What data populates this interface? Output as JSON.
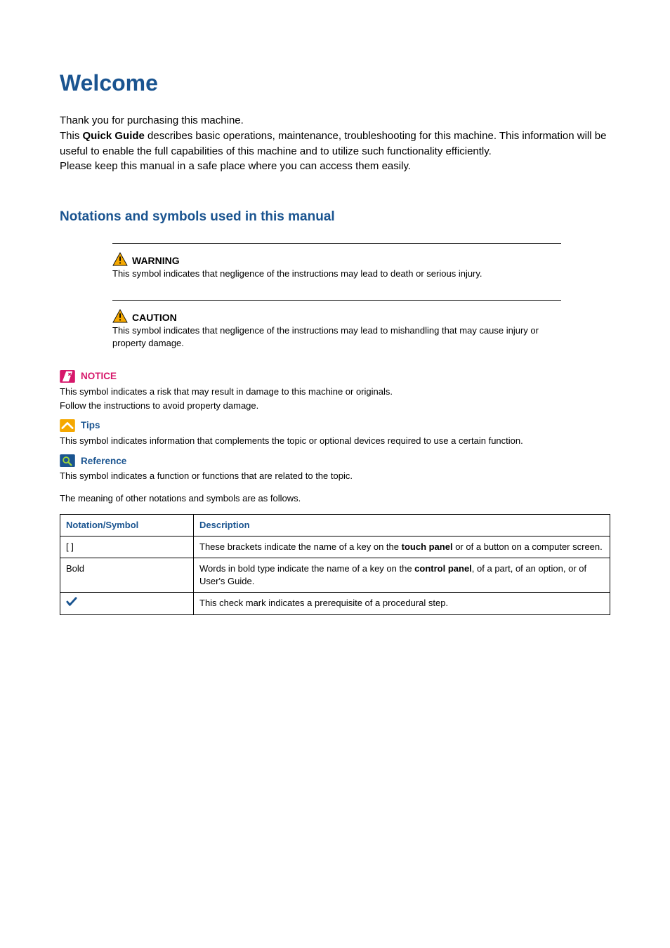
{
  "title": "Welcome",
  "intro": {
    "line1": "Thank you for purchasing this machine.",
    "line2_pre": "This ",
    "line2_bold": "Quick Guide",
    "line2_post": " describes basic operations, maintenance, troubleshooting for this machine. This information will be useful to enable the full capabilities of this machine and to utilize such functionality efficiently.",
    "line3": "Please keep this manual in a safe place where you can access them easily."
  },
  "section_heading": "Notations and symbols used in this manual",
  "warning": {
    "label": "WARNING",
    "text": "This symbol indicates that negligence of the instructions may lead to death or serious injury."
  },
  "caution": {
    "label": "CAUTION",
    "text": "This symbol indicates that negligence of the instructions may lead to mishandling that may cause injury or property damage."
  },
  "notice": {
    "label": "NOTICE",
    "text1": "This symbol indicates a risk that may result in damage to this machine or originals.",
    "text2": "Follow the instructions to avoid property damage."
  },
  "tips": {
    "label": "Tips",
    "text": "This symbol indicates information that complements the topic or optional devices required to use a certain function."
  },
  "reference": {
    "label": "Reference",
    "text": "This symbol indicates a function or functions that are related to the topic."
  },
  "table_intro": "The meaning of other notations and symbols are as follows.",
  "table": {
    "headers": {
      "col1": "Notation/Symbol",
      "col2": "Description"
    },
    "rows": [
      {
        "notation": "[ ]",
        "desc_pre": "These brackets indicate the name of a key on the ",
        "desc_bold": "touch panel",
        "desc_post": " or of a button on a computer screen."
      },
      {
        "notation": "Bold",
        "desc_pre": "Words in bold type indicate the name of a key on the ",
        "desc_bold": "control panel",
        "desc_post": ", of a part, of an option, or of User's Guide."
      },
      {
        "notation": "CHECK",
        "desc_pre": "This check mark indicates a prerequisite of a procedural step.",
        "desc_bold": "",
        "desc_post": ""
      }
    ]
  }
}
